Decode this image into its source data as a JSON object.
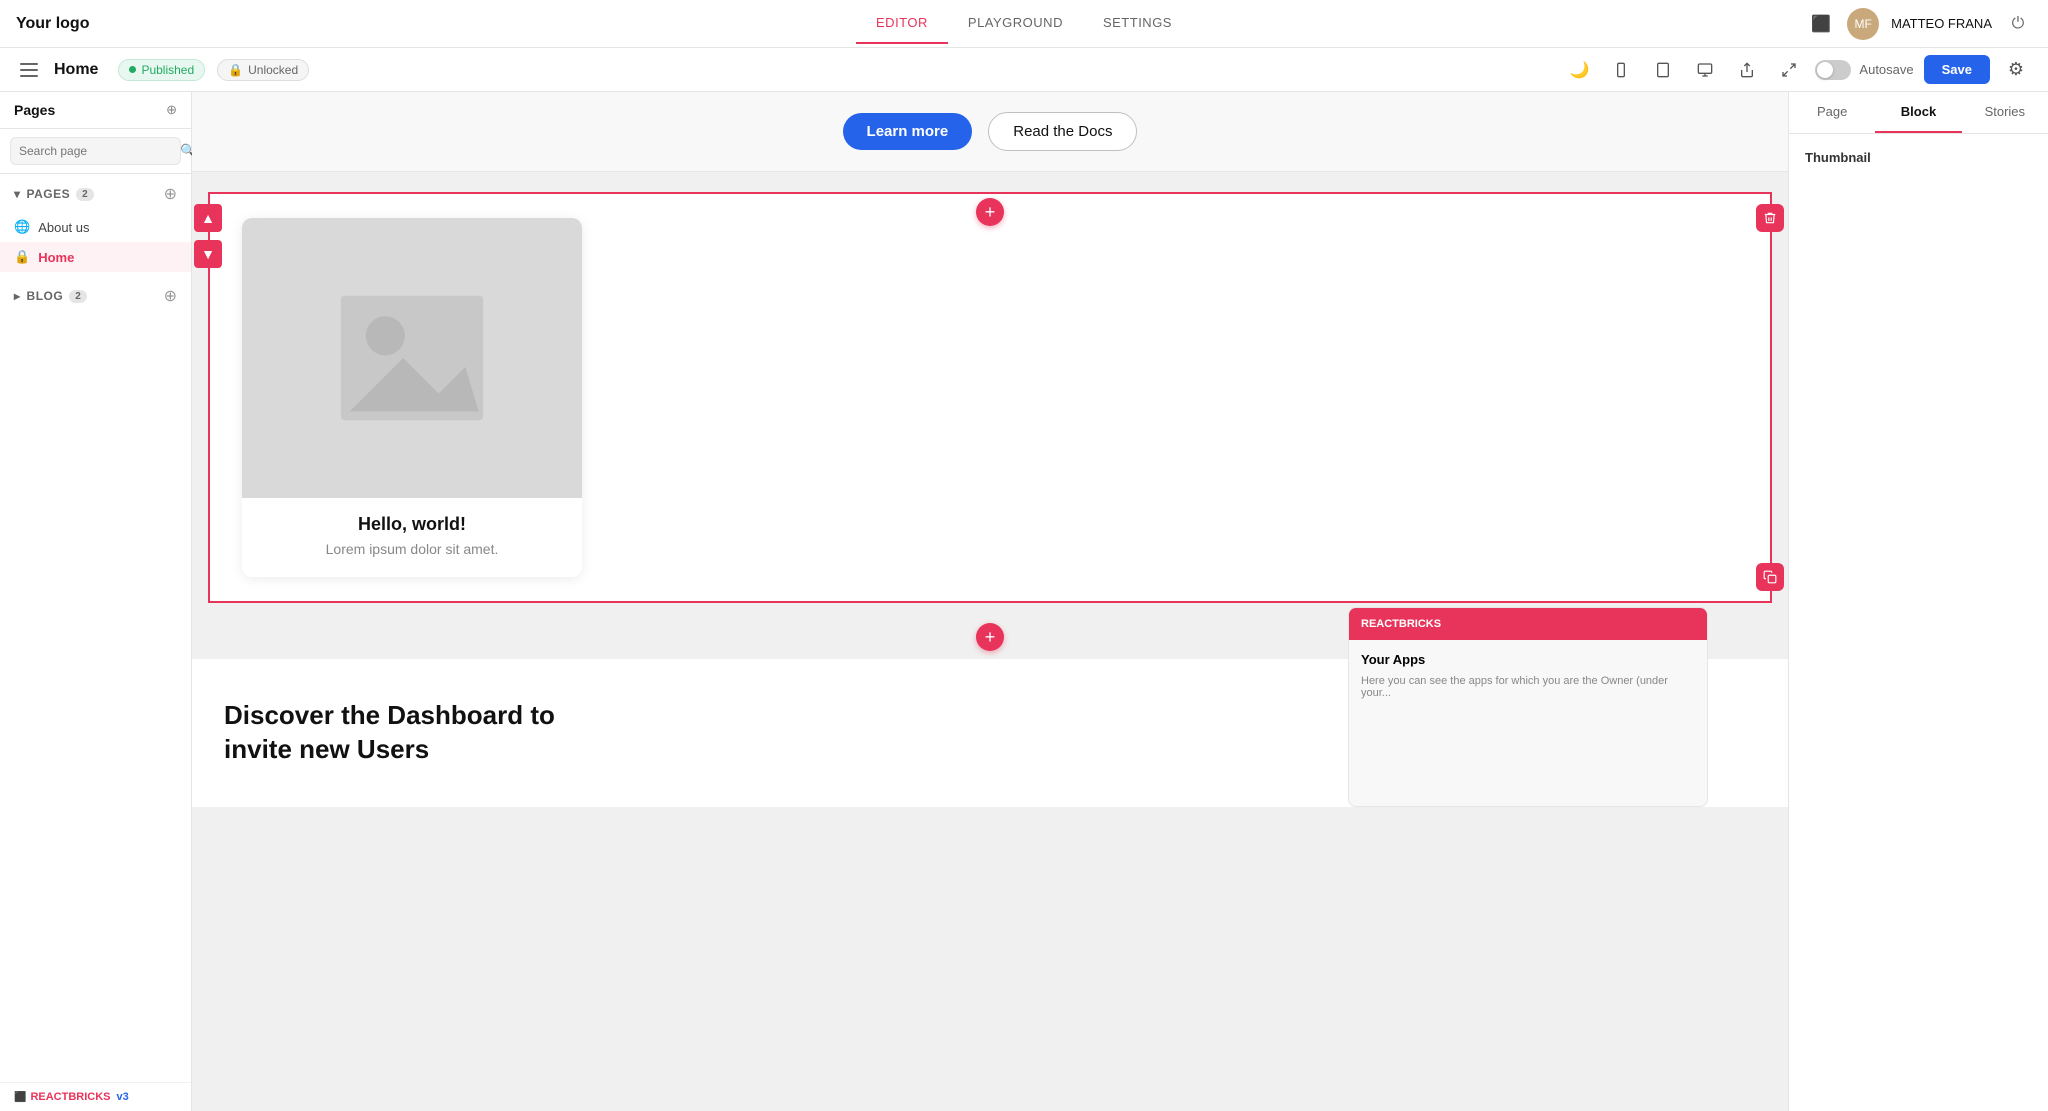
{
  "app": {
    "logo": "Your logo",
    "nav_tabs": [
      {
        "label": "EDITOR",
        "active": true
      },
      {
        "label": "PLAYGROUND",
        "active": false
      },
      {
        "label": "SETTINGS",
        "active": false
      }
    ],
    "user_name": "MATTEO FRANA",
    "autosave_label": "Autosave",
    "save_label": "Save"
  },
  "page_header": {
    "title": "Home",
    "published_label": "Published",
    "unlocked_label": "Unlocked"
  },
  "sidebar": {
    "title": "Pages",
    "search_placeholder": "Search page",
    "pages_section_label": "PAGES",
    "pages_count": "2",
    "pages": [
      {
        "label": "About us",
        "active": false,
        "locked": false
      },
      {
        "label": "Home",
        "active": true,
        "locked": true
      }
    ],
    "blog_section_label": "BLOG",
    "blog_count": "2",
    "footer_logo": "REACTBRICKS",
    "footer_version": "v3"
  },
  "editor": {
    "learn_more_btn": "Learn more",
    "read_docs_btn": "Read the Docs",
    "card": {
      "title": "Hello, world!",
      "subtitle": "Lorem ipsum dolor sit amet."
    },
    "add_block_label": "+",
    "up_arrow": "▲",
    "down_arrow": "▼",
    "delete_icon": "🗑",
    "duplicate_icon": "⧉"
  },
  "bottom_section": {
    "heading": "Discover the Dashboard to invite new Users"
  },
  "right_panel": {
    "tabs": [
      {
        "label": "Page",
        "active": false
      },
      {
        "label": "Block",
        "active": true
      },
      {
        "label": "Stories",
        "active": false
      }
    ],
    "section_title": "Thumbnail"
  },
  "icons": {
    "moon": "🌙",
    "mobile": "📱",
    "tablet": "⊞",
    "desktop": "🖥",
    "share": "⇪",
    "expand": "⤢",
    "gear": "⚙",
    "search": "🔍",
    "menu": "☰",
    "new_page": "⊕",
    "lock": "🔒",
    "globe": "🌐",
    "chevron_down": "▾",
    "chevron_right": "▸",
    "monitor": "🖥"
  }
}
